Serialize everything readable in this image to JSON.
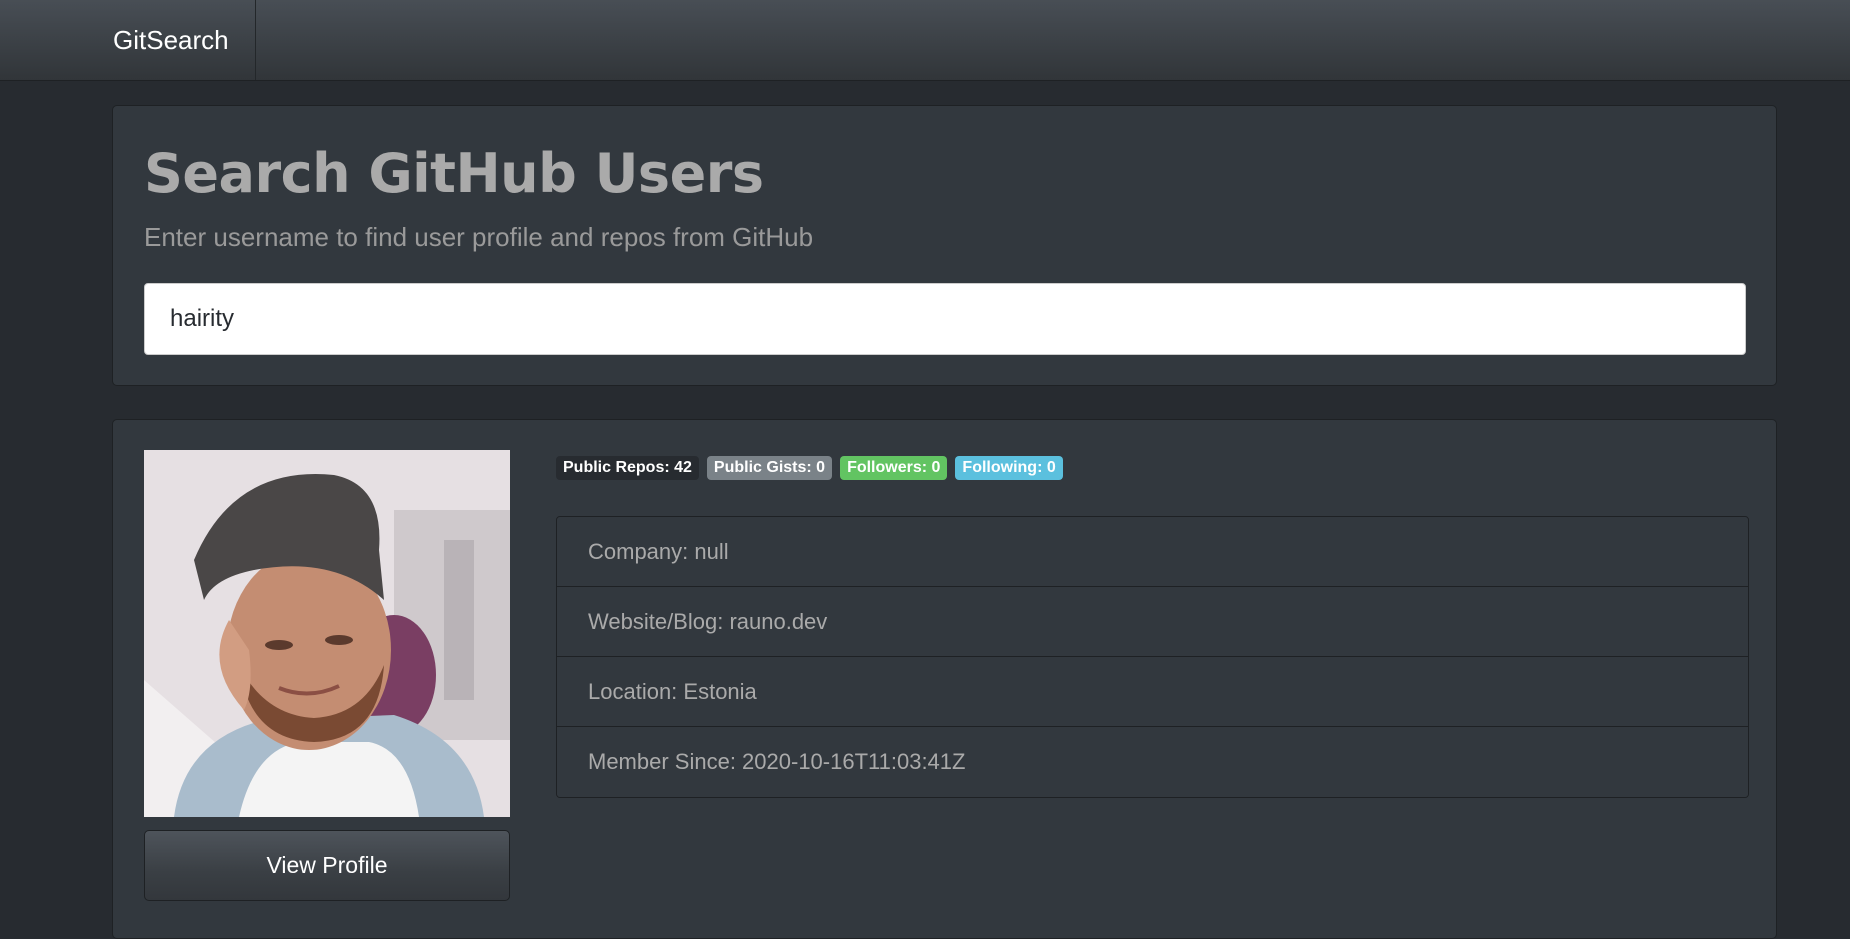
{
  "navbar": {
    "brand": "GitSearch"
  },
  "search": {
    "title": "Search GitHub Users",
    "subtitle": "Enter username to find user profile and repos from GitHub",
    "input_value": "hairity"
  },
  "profile": {
    "view_profile_label": "View Profile",
    "badges": [
      {
        "label": "Public Repos: 42",
        "color": "#272b30"
      },
      {
        "label": "Public Gists: 0",
        "color": "#7a8288"
      },
      {
        "label": "Followers: 0",
        "color": "#62c462"
      },
      {
        "label": "Following: 0",
        "color": "#5bc0de"
      }
    ],
    "details": [
      "Company: null",
      "Website/Blog: rauno.dev",
      "Location: Estonia",
      "Member Since: 2020-10-16T11:03:41Z"
    ]
  }
}
